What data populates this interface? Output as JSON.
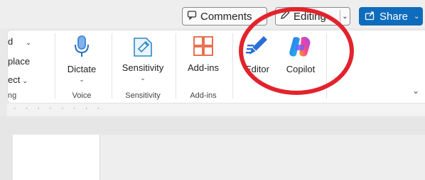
{
  "header": {
    "comments_label": "Comments",
    "editing_label": "Editing",
    "share_label": "Share"
  },
  "ribbon": {
    "partial": {
      "row1": "d",
      "row2": "place",
      "row3": "ect",
      "group": "ng"
    },
    "voice": {
      "tool_label": "Dictate",
      "group_label": "Voice"
    },
    "sensitivity": {
      "tool_label": "Sensitivity",
      "group_label": "Sensitivity"
    },
    "addins": {
      "tool_label": "Add-ins",
      "group_label": "Add-ins"
    },
    "editor": {
      "tool_label": "Editor"
    },
    "copilot": {
      "tool_label": "Copilot"
    }
  },
  "ruler": {
    "marks": "· · · · · · · ·"
  },
  "colors": {
    "accent": "#0f6cbd",
    "highlight": "#e3232c",
    "addins_icon": "#e8613c"
  },
  "icons": {
    "comments": "comment-icon",
    "editing": "pencil-icon",
    "share": "share-icon",
    "dictate": "microphone-icon",
    "sensitivity": "sensitivity-label-icon",
    "addins": "grid-icon",
    "editor": "editor-pen-icon",
    "copilot": "copilot-icon",
    "collapse": "chevron-down-icon"
  }
}
